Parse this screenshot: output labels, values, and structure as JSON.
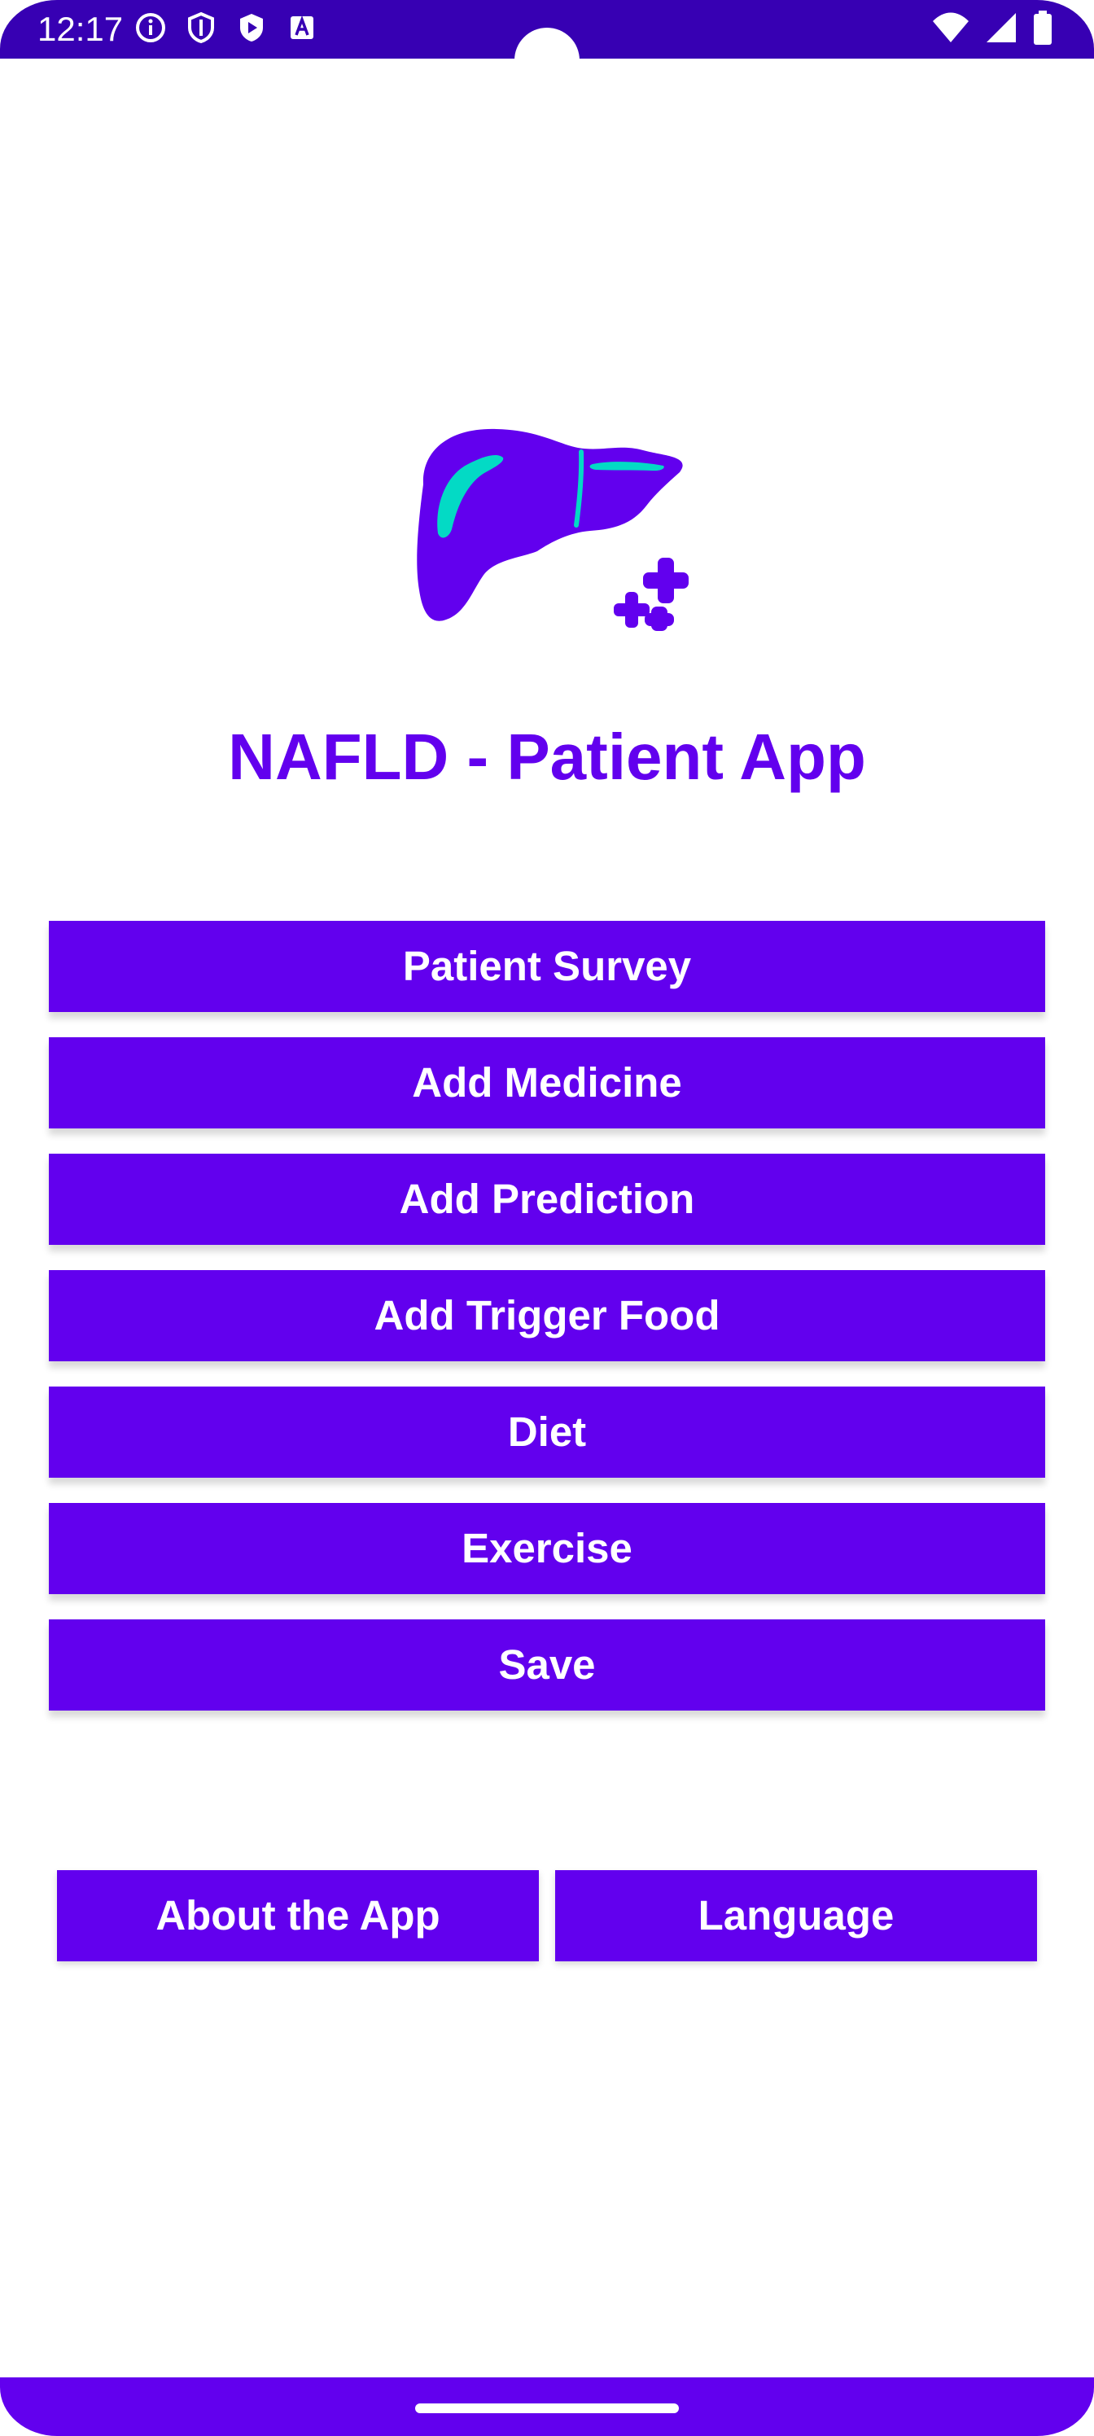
{
  "status_bar": {
    "time": "12:17",
    "left_icons": [
      "info-icon",
      "shield-icon",
      "play-protect-icon",
      "font-a-icon"
    ],
    "right_icons": [
      "wifi-icon",
      "signal-icon",
      "battery-icon"
    ]
  },
  "app": {
    "title": "NAFLD - Patient App",
    "logo_icon": "liver-medical-icon"
  },
  "menu": {
    "patient_survey": "Patient Survey",
    "add_medicine": "Add Medicine",
    "add_prediction": "Add Prediction",
    "add_trigger_food": "Add Trigger Food",
    "diet": "Diet",
    "exercise": "Exercise",
    "save": "Save"
  },
  "footer": {
    "about": "About the App",
    "language": "Language"
  },
  "colors": {
    "primary": "#6200EE",
    "status_bar": "#3700B3",
    "accent": "#03DAC5"
  }
}
